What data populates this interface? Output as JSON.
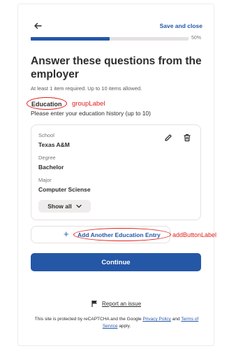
{
  "header": {
    "save_close_label": "Save and close",
    "progress_percent": 50,
    "progress_label": "50%"
  },
  "page": {
    "title": "Answer these questions from the employer",
    "hint": "At least 1 item required. Up to 10 items allowed."
  },
  "group": {
    "label": "Education",
    "description": "Please enter your education history (up to 10)"
  },
  "entry": {
    "fields": [
      {
        "label": "School",
        "value": "Texas A&M"
      },
      {
        "label": "Degree",
        "value": "Bachelor"
      },
      {
        "label": "Major",
        "value": "Computer Sciense"
      }
    ],
    "show_all_label": "Show all"
  },
  "add_entry": {
    "label": "Add Another Education Entry"
  },
  "annotations": {
    "group_label": "groupLabel",
    "add_button_label": "addButtonLabel"
  },
  "continue_label": "Continue",
  "report": {
    "label": "Report an issue"
  },
  "recaptcha": {
    "prefix": "This site is protected by reCAPTCHA and the Google",
    "privacy_link": "Privacy Policy",
    "and": "and",
    "terms_link": "Terms of Service",
    "suffix": "apply."
  },
  "colors": {
    "accent": "#2557a7",
    "annotation": "#e3201b"
  },
  "icons": {
    "back": "arrow-left-icon",
    "edit": "pencil-icon",
    "delete": "trash-icon",
    "show_all": "chevron-down-icon",
    "add": "plus-icon",
    "report": "flag-icon"
  }
}
